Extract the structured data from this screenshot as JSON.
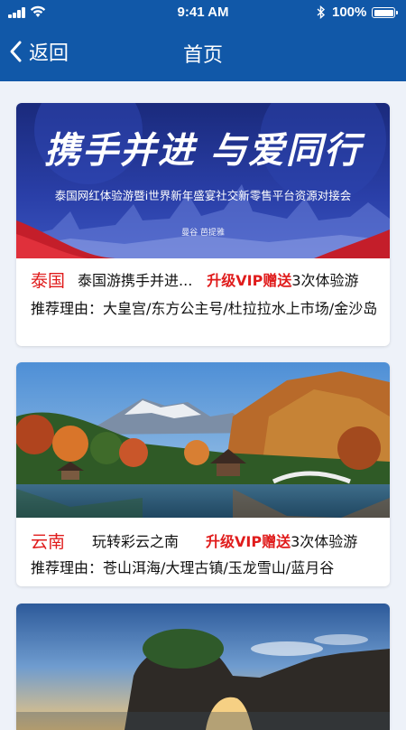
{
  "status_bar": {
    "time": "9:41 AM",
    "battery": "100%"
  },
  "nav": {
    "back_label": "返回",
    "title": "首页"
  },
  "cards": [
    {
      "banner_title": "携手并进 与爱同行",
      "banner_sub": "泰国网红体验游暨i世界新年盛宴社交新零售平台资源对接会",
      "banner_small": "曼谷 芭提雅",
      "region": "泰国",
      "subtitle": "泰国游携手并进...",
      "vip": "升级VIP赠送",
      "tail": "3次体验游",
      "reason_label": "推荐理由：",
      "reasons": "大皇宫/东方公主号/杜拉拉水上市场/金沙岛"
    },
    {
      "region": "云南",
      "subtitle": "玩转彩云之南",
      "vip": "升级VIP赠送",
      "tail": "3次体验游",
      "reason_label": "推荐理由：",
      "reasons": "苍山洱海/大理古镇/玉龙雪山/蓝月谷"
    },
    {}
  ]
}
